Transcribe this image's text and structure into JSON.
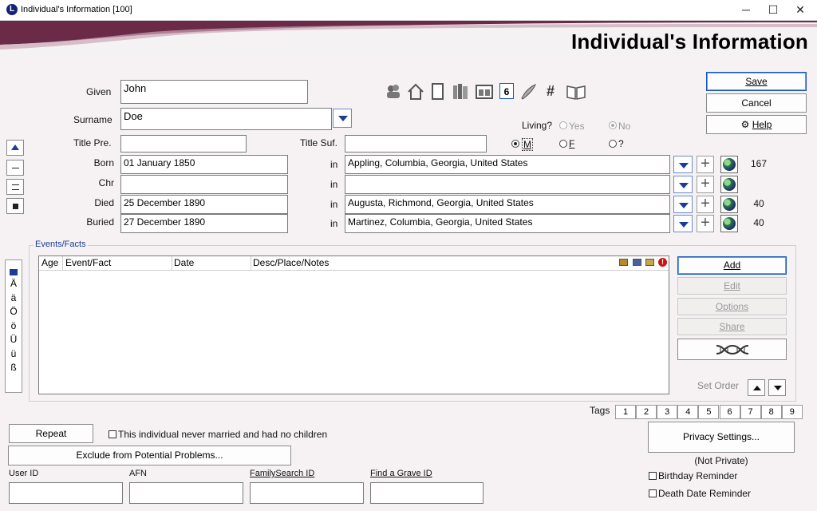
{
  "window": {
    "title": "Individual's Information  [100]",
    "logo": "L",
    "min": "─",
    "max": "☐",
    "close": "✕"
  },
  "banner": {
    "title": "Individual's Information"
  },
  "name": {
    "given_label": "Given",
    "given_value": "John",
    "surname_label": "Surname",
    "surname_value": "Doe",
    "title_pre_label": "Title Pre.",
    "title_pre_value": "",
    "title_suf_label": "Title Suf.",
    "title_suf_value": ""
  },
  "living": {
    "label": "Living?",
    "yes": "Yes",
    "no": "No",
    "selected": "No"
  },
  "sex": {
    "m": "M",
    "f": "F",
    "unknown": "?",
    "selected": "M"
  },
  "buttons": {
    "save": "Save",
    "cancel": "Cancel",
    "help": "Help",
    "help_icon": "⚙"
  },
  "events_main": [
    {
      "label": "Born",
      "date": "01 January 1850",
      "in": "in",
      "place": "Appling, Columbia, Georgia, United States",
      "count": "167"
    },
    {
      "label": "Chr",
      "date": "",
      "in": "in",
      "place": "",
      "count": ""
    },
    {
      "label": "Died",
      "date": "25 December 1890",
      "in": "in",
      "place": "Augusta, Richmond, Georgia, United States",
      "count": "40"
    },
    {
      "label": "Buried",
      "date": "27 December 1890",
      "in": "in",
      "place": "Martinez, Columbia, Georgia, United States",
      "count": "40"
    }
  ],
  "toolbar_icons": [
    "people-icon",
    "house-icon",
    "document-icon",
    "books-icon",
    "photo-icon",
    "calendar-icon",
    "notes-quill-icon",
    "hash-icon",
    "open-book-icon"
  ],
  "toolbar_glyphs": {
    "calendar": "6",
    "hash": "#"
  },
  "side_chars": [
    "Ä",
    "ä",
    "Ö",
    "ö",
    "Ü",
    "ü",
    "ß"
  ],
  "events_facts": {
    "group_label": "Events/Facts",
    "columns": [
      "Age",
      "Event/Fact",
      "Date",
      "Desc/Place/Notes"
    ],
    "rows": [],
    "buttons": {
      "add": "Add",
      "edit": "Edit",
      "options": "Options",
      "share": "Share"
    },
    "set_order_label": "Set Order"
  },
  "tags": {
    "label": "Tags",
    "items": [
      "1",
      "2",
      "3",
      "4",
      "5",
      "6",
      "7",
      "8",
      "9"
    ]
  },
  "bottom": {
    "repeat": "Repeat",
    "never_married": "This individual never married and had no children",
    "exclude": "Exclude from Potential Problems...",
    "user_id_label": "User ID",
    "user_id_value": "",
    "afn_label": "AFN",
    "afn_value": "",
    "familysearch_label": "FamilySearch ID",
    "familysearch_value": "",
    "findagrave_label": "Find a Grave ID",
    "findagrave_value": "",
    "privacy_button": "Privacy Settings...",
    "privacy_status": "(Not Private)",
    "birthday_reminder": "Birthday Reminder",
    "death_date_reminder": "Death Date Reminder"
  },
  "colors": {
    "accent": "#1a3c96",
    "banner_stripe": "#7c3550",
    "window_bg": "#f6f2f3"
  }
}
